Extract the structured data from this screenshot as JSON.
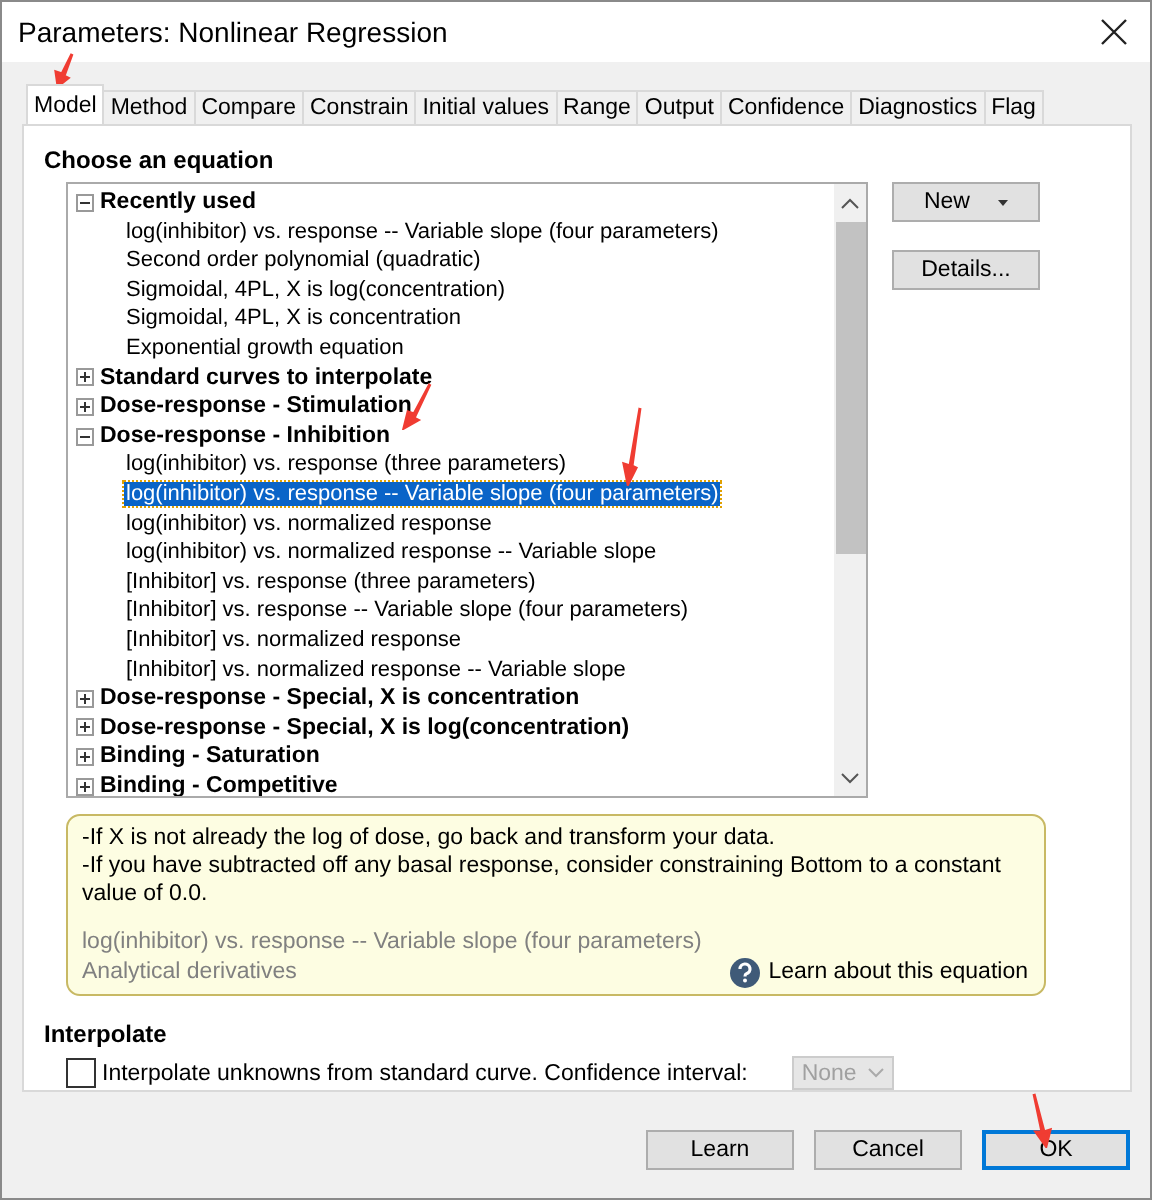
{
  "window": {
    "title": "Parameters: Nonlinear Regression"
  },
  "tabs": [
    {
      "label": "Model",
      "selected": true
    },
    {
      "label": "Method",
      "selected": false
    },
    {
      "label": "Compare",
      "selected": false
    },
    {
      "label": "Constrain",
      "selected": false
    },
    {
      "label": "Initial values",
      "selected": false
    },
    {
      "label": "Range",
      "selected": false
    },
    {
      "label": "Output",
      "selected": false
    },
    {
      "label": "Confidence",
      "selected": false
    },
    {
      "label": "Diagnostics",
      "selected": false
    },
    {
      "label": "Flag",
      "selected": false
    }
  ],
  "equation_section": {
    "heading": "Choose an equation"
  },
  "tree": [
    {
      "label": "Recently used",
      "expanded": true,
      "children": [
        {
          "label": "log(inhibitor) vs. response -- Variable slope (four parameters)",
          "selected": false
        },
        {
          "label": "Second order polynomial (quadratic)",
          "selected": false
        },
        {
          "label": "Sigmoidal, 4PL, X is log(concentration)",
          "selected": false
        },
        {
          "label": "Sigmoidal, 4PL, X is concentration",
          "selected": false
        },
        {
          "label": "Exponential growth equation",
          "selected": false
        }
      ]
    },
    {
      "label": "Standard curves to interpolate",
      "expanded": false
    },
    {
      "label": "Dose-response - Stimulation",
      "expanded": false
    },
    {
      "label": "Dose-response - Inhibition",
      "expanded": true,
      "children": [
        {
          "label": "log(inhibitor) vs. response (three parameters)",
          "selected": false
        },
        {
          "label": "log(inhibitor) vs. response -- Variable slope (four parameters)",
          "selected": true
        },
        {
          "label": "log(inhibitor) vs. normalized response",
          "selected": false
        },
        {
          "label": "log(inhibitor) vs. normalized response -- Variable slope",
          "selected": false
        },
        {
          "label": "[Inhibitor] vs. response (three parameters)",
          "selected": false
        },
        {
          "label": "[Inhibitor] vs. response -- Variable slope (four parameters)",
          "selected": false
        },
        {
          "label": "[Inhibitor] vs. normalized response",
          "selected": false
        },
        {
          "label": "[Inhibitor] vs. normalized response -- Variable slope",
          "selected": false
        }
      ]
    },
    {
      "label": "Dose-response - Special, X is concentration",
      "expanded": false
    },
    {
      "label": "Dose-response - Special, X is log(concentration)",
      "expanded": false
    },
    {
      "label": "Binding - Saturation",
      "expanded": false
    },
    {
      "label": "Binding - Competitive",
      "expanded": false
    }
  ],
  "side_buttons": [
    {
      "label": "New",
      "dropdown": true
    },
    {
      "label": "Details...",
      "dropdown": false
    }
  ],
  "info": {
    "notes": [
      "-If X is not already the log of dose, go back and transform your data.",
      "-If you have subtracted off any  basal response, consider constraining Bottom to a constant value of 0.0."
    ],
    "equation": "log(inhibitor) vs. response -- Variable slope (four parameters)",
    "derivatives": "Analytical derivatives",
    "help_link": "Learn about this equation"
  },
  "interpolate": {
    "heading": "Interpolate",
    "checkbox": {
      "label": "Interpolate unknowns from standard curve. Confidence interval:",
      "checked": false
    },
    "confidence_select": {
      "value": "None",
      "disabled": true
    }
  },
  "buttons": [
    {
      "label": "Learn",
      "default": false
    },
    {
      "label": "Cancel",
      "default": false
    },
    {
      "label": "OK",
      "default": true
    }
  ]
}
